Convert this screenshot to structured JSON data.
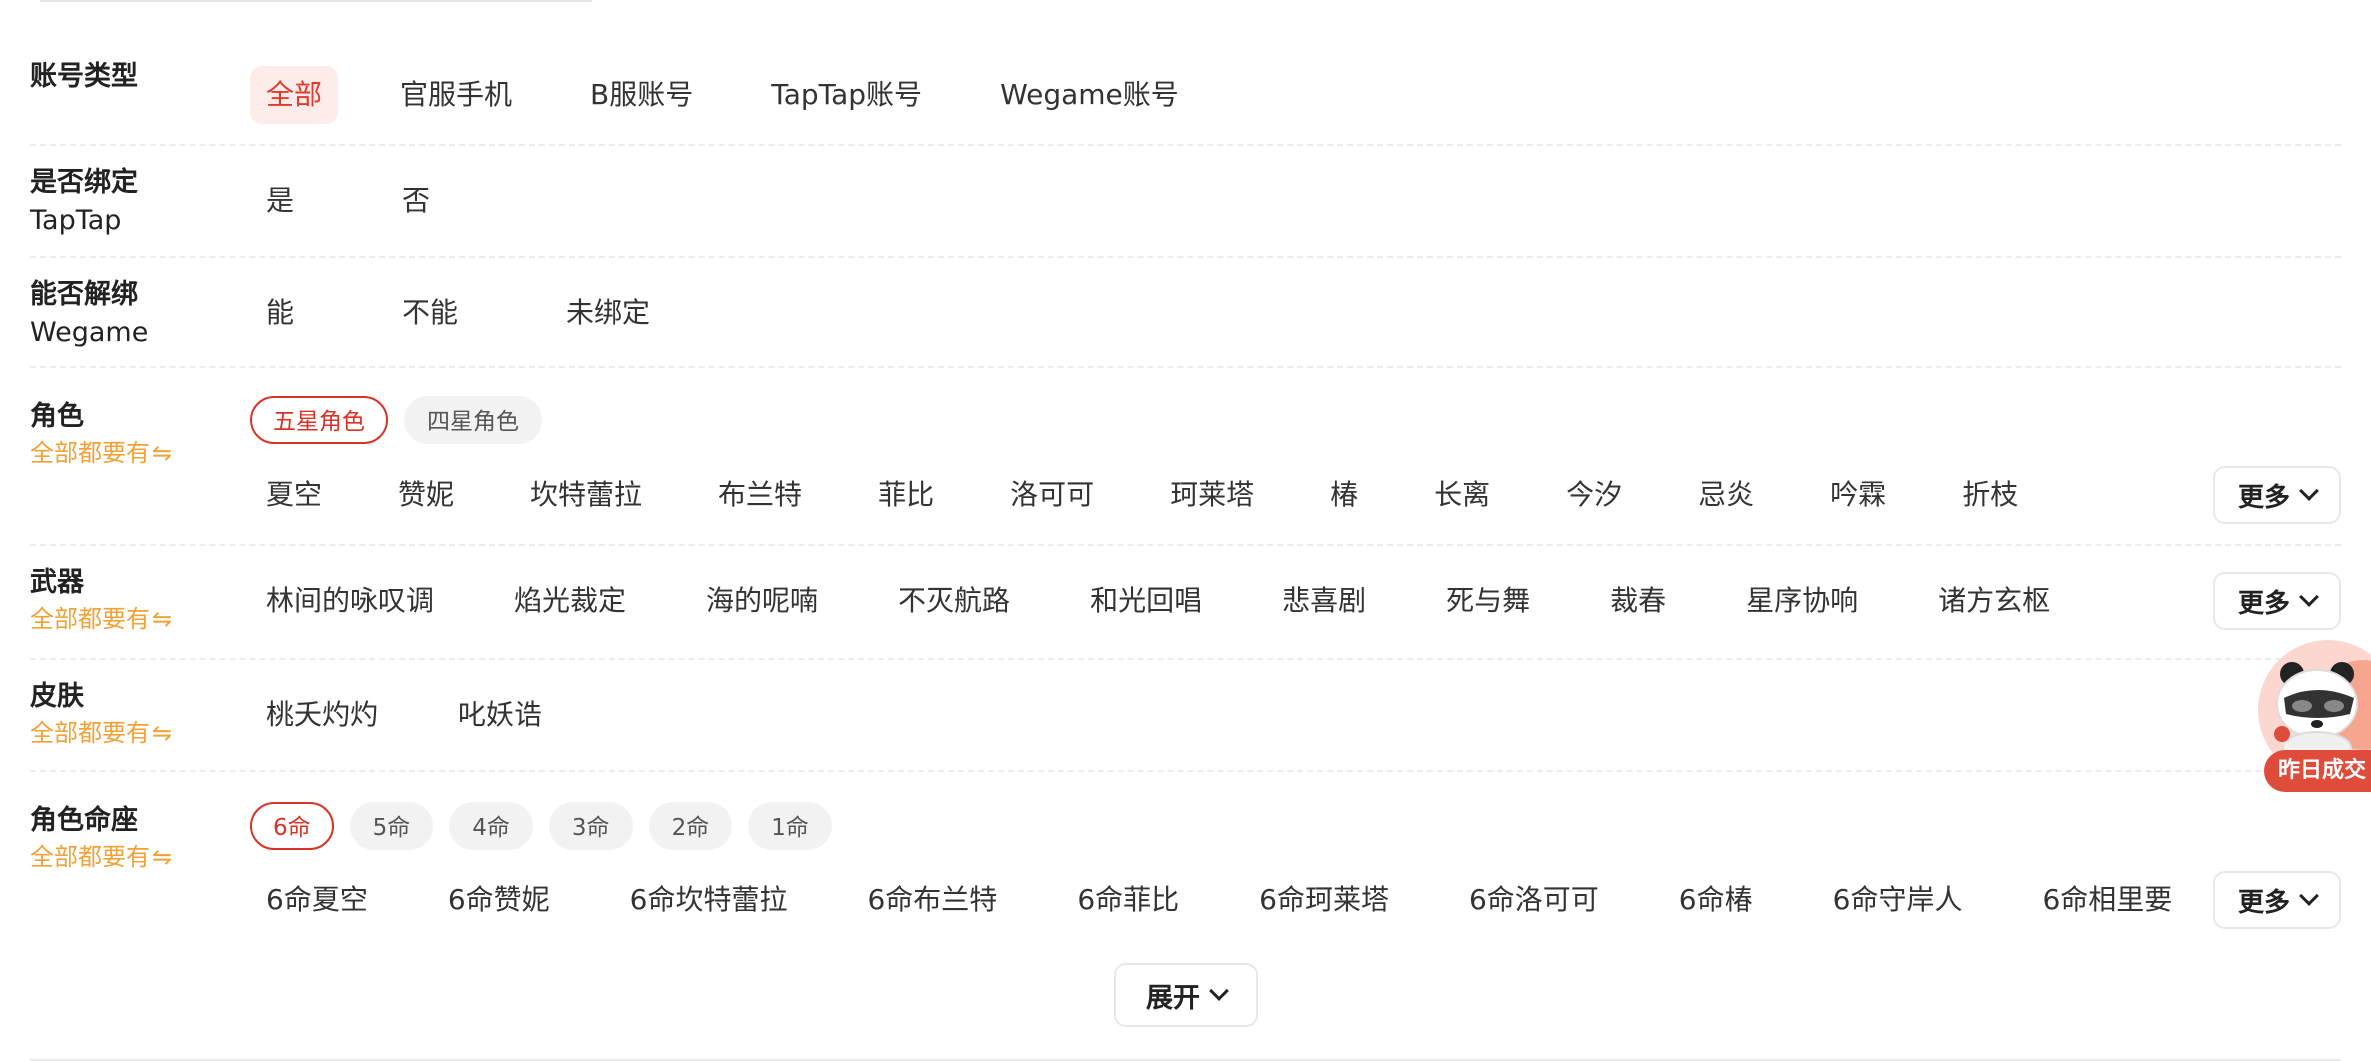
{
  "account_type": {
    "label": "账号类型",
    "options": [
      "全部",
      "官服手机",
      "B服账号",
      "TapTap账号",
      "Wegame账号"
    ]
  },
  "taptap_bound": {
    "label_line1": "是否绑定",
    "label_line2": "TapTap",
    "options": [
      "是",
      "否"
    ]
  },
  "wegame_unbind": {
    "label_line1": "能否解绑",
    "label_line2": "Wegame",
    "options": [
      "能",
      "不能",
      "未绑定"
    ]
  },
  "character": {
    "label": "角色",
    "sub_label": "全部都要有",
    "tabs": [
      "五星角色",
      "四星角色"
    ],
    "options": [
      "夏空",
      "赞妮",
      "坎特蕾拉",
      "布兰特",
      "菲比",
      "洛可可",
      "珂莱塔",
      "椿",
      "长离",
      "今汐",
      "忌炎",
      "吟霖",
      "折枝"
    ],
    "more_label": "更多"
  },
  "weapon": {
    "label": "武器",
    "sub_label": "全部都要有",
    "options": [
      "林间的咏叹调",
      "焰光裁定",
      "海的呢喃",
      "不灭航路",
      "和光回唱",
      "悲喜剧",
      "死与舞",
      "裁春",
      "星序协响",
      "诸方玄枢"
    ],
    "more_label": "更多"
  },
  "skin": {
    "label": "皮肤",
    "sub_label": "全部都要有",
    "options": [
      "桃夭灼灼",
      "叱妖诰"
    ]
  },
  "constellation": {
    "label": "角色命座",
    "sub_label": "全部都要有",
    "tabs": [
      "6命",
      "5命",
      "4命",
      "3命",
      "2命",
      "1命"
    ],
    "options": [
      "6命夏空",
      "6命赞妮",
      "6命坎特蕾拉",
      "6命布兰特",
      "6命菲比",
      "6命珂莱塔",
      "6命洛可可",
      "6命椿",
      "6命守岸人",
      "6命相里要"
    ],
    "more_label": "更多"
  },
  "expand_label": "展开",
  "float_widget": {
    "label": "昨日成交"
  },
  "colors": {
    "accent": "#e23b2e",
    "sub_label": "#f2a136"
  }
}
